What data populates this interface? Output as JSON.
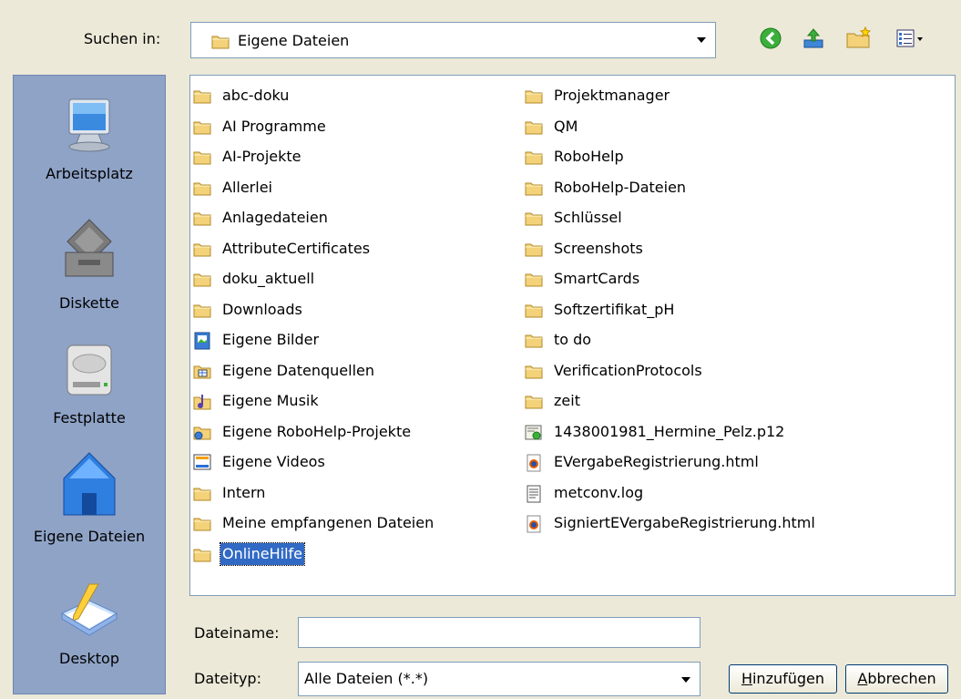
{
  "lookin": {
    "label": "Suchen in:",
    "value": "Eigene Dateien"
  },
  "toolbar": {
    "back": "back-icon",
    "up": "up-folder-icon",
    "newfolder": "new-folder-icon",
    "views": "views-menu-icon"
  },
  "places": [
    {
      "label": "Arbeitsplatz",
      "icon": "computer-icon"
    },
    {
      "label": "Diskette",
      "icon": "floppy-icon"
    },
    {
      "label": "Festplatte",
      "icon": "harddisk-icon"
    },
    {
      "label": "Eigene Dateien",
      "icon": "my-documents-icon"
    },
    {
      "label": "Desktop",
      "icon": "desktop-icon"
    }
  ],
  "files": {
    "col1": [
      {
        "name": "abc-doku",
        "icon": "folder"
      },
      {
        "name": "AI Programme",
        "icon": "folder"
      },
      {
        "name": "AI-Projekte",
        "icon": "folder"
      },
      {
        "name": "Allerlei",
        "icon": "folder"
      },
      {
        "name": "Anlagedateien",
        "icon": "folder"
      },
      {
        "name": "AttributeCertificates",
        "icon": "folder"
      },
      {
        "name": "doku_aktuell",
        "icon": "folder"
      },
      {
        "name": "Downloads",
        "icon": "folder"
      },
      {
        "name": "Eigene Bilder",
        "icon": "pictures"
      },
      {
        "name": "Eigene Datenquellen",
        "icon": "datasource"
      },
      {
        "name": "Eigene Musik",
        "icon": "music"
      },
      {
        "name": "Eigene RoboHelp-Projekte",
        "icon": "robohelp"
      },
      {
        "name": "Eigene Videos",
        "icon": "video"
      },
      {
        "name": "Intern",
        "icon": "folder"
      },
      {
        "name": "Meine empfangenen Dateien",
        "icon": "folder"
      },
      {
        "name": "OnlineHilfe",
        "icon": "folder",
        "selected": true
      }
    ],
    "col2": [
      {
        "name": "Projektmanager",
        "icon": "folder"
      },
      {
        "name": "QM",
        "icon": "folder"
      },
      {
        "name": "RoboHelp",
        "icon": "folder"
      },
      {
        "name": "RoboHelp-Dateien",
        "icon": "folder"
      },
      {
        "name": "Schlüssel",
        "icon": "folder"
      },
      {
        "name": "Screenshots",
        "icon": "folder"
      },
      {
        "name": "SmartCards",
        "icon": "folder"
      },
      {
        "name": "Softzertifikat_pH",
        "icon": "folder"
      },
      {
        "name": "to do",
        "icon": "folder"
      },
      {
        "name": "VerificationProtocols",
        "icon": "folder"
      },
      {
        "name": "zeit",
        "icon": "folder"
      },
      {
        "name": "1438001981_Hermine_Pelz.p12",
        "icon": "certificate"
      },
      {
        "name": "EVergabeRegistrierung.html",
        "icon": "firefox-html"
      },
      {
        "name": "metconv.log",
        "icon": "textfile"
      },
      {
        "name": "SigniertEVergabeRegistrierung.html",
        "icon": "firefox-html"
      }
    ]
  },
  "filename": {
    "label": "Dateiname:",
    "value": ""
  },
  "filetype": {
    "label": "Dateityp:",
    "value": "Alle Dateien (*.*)"
  },
  "buttons": {
    "add": {
      "accel": "H",
      "rest": "inzufügen"
    },
    "cancel": {
      "accel": "A",
      "rest": "bbrechen"
    }
  },
  "colors": {
    "dialog_bg": "#ece9d8",
    "places_bg": "#8fa3c7",
    "selection": "#316ac5",
    "folder": "#f3d27a"
  }
}
